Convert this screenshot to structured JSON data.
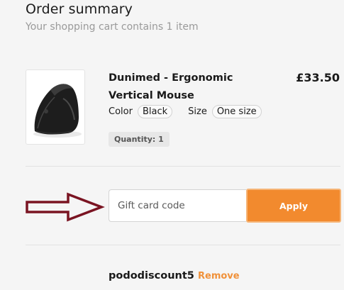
{
  "header": {
    "title": "Order summary",
    "subtitle": "Your shopping cart contains 1 item"
  },
  "item": {
    "name": "Dunimed - Ergonomic Vertical Mouse",
    "price": "£33.50",
    "image_icon": "mouse-product-image",
    "options": [
      {
        "label": "Color",
        "value": "Black"
      },
      {
        "label": "Size",
        "value": "One size"
      }
    ],
    "quantity": "Quantity: 1"
  },
  "gift_card": {
    "placeholder": "Gift card code",
    "value": "",
    "apply_label": "Apply"
  },
  "discount": {
    "code": "pododiscount5",
    "remove_label": "Remove"
  },
  "colors": {
    "accent": "#f28a2e",
    "annotation_arrow": "#7a1422",
    "background": "#f5f5f5"
  }
}
